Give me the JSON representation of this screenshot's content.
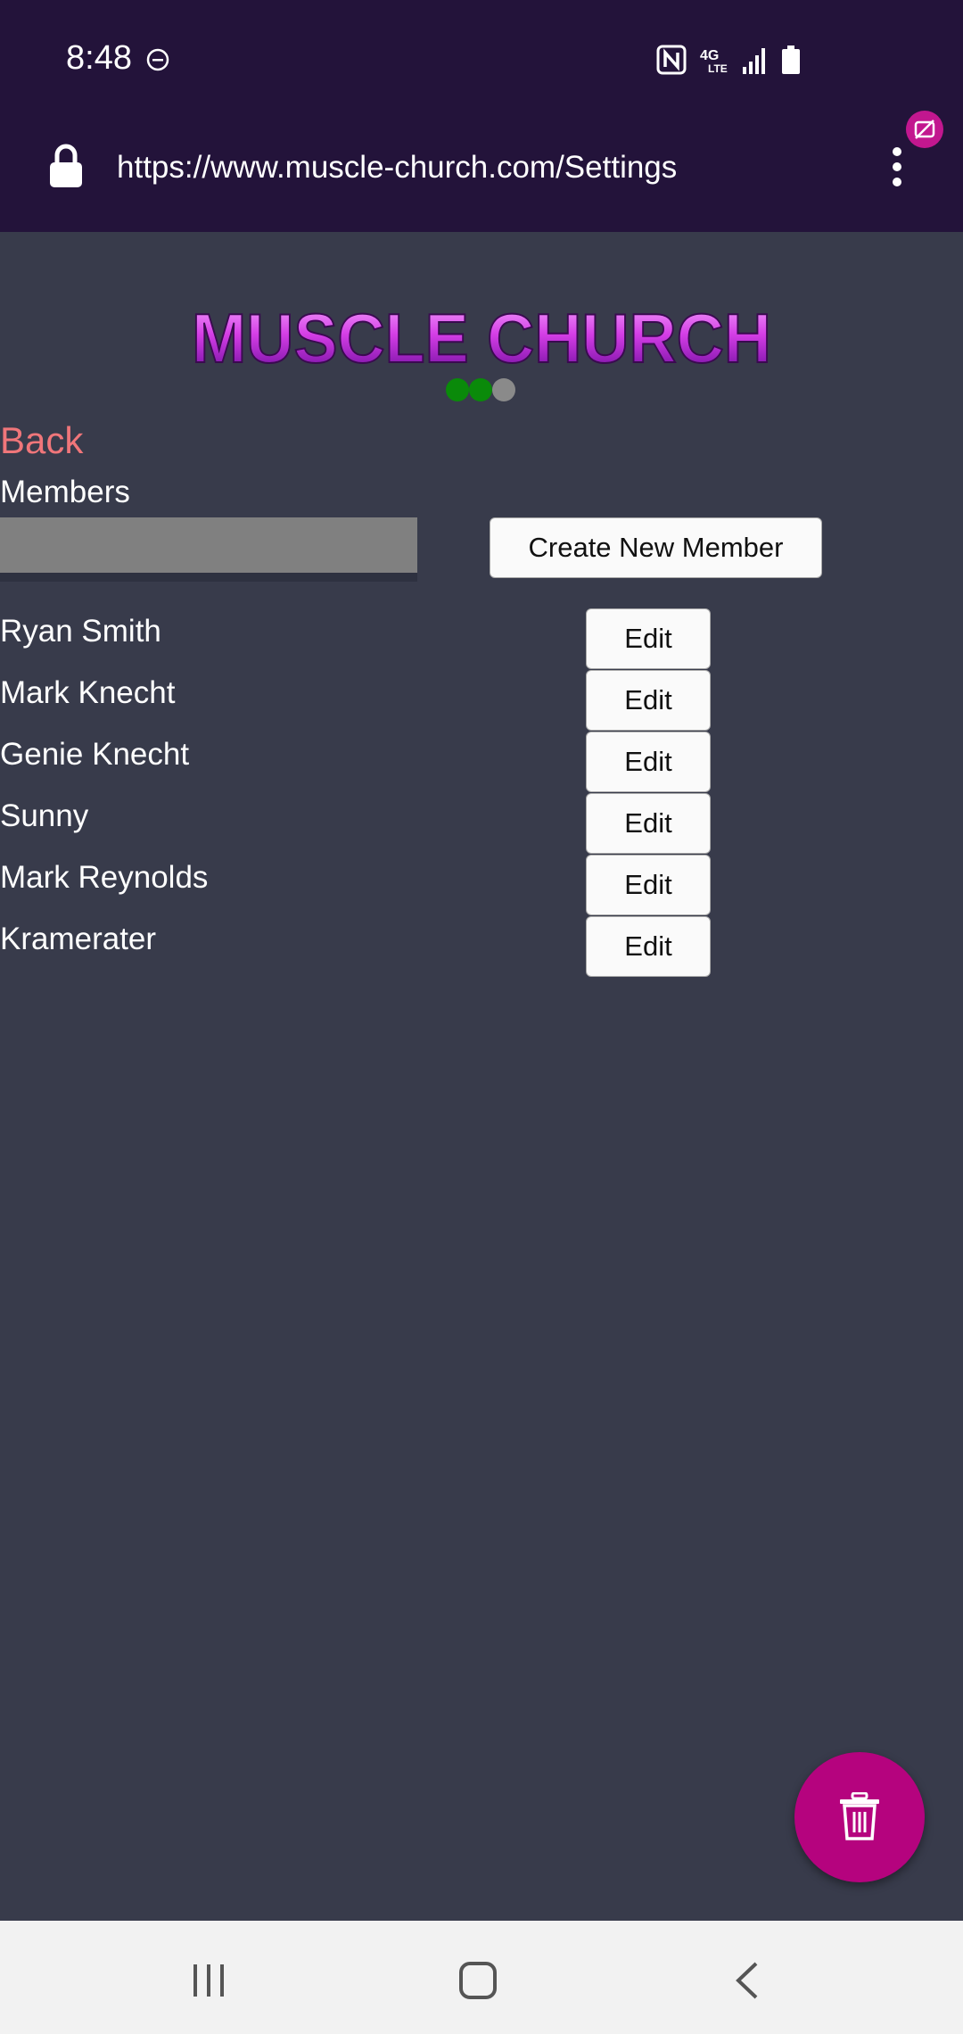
{
  "status_bar": {
    "time": "8:48",
    "icons": [
      "do-not-disturb-icon",
      "nfc-icon",
      "4g-lte-icon",
      "signal-icon",
      "battery-icon"
    ]
  },
  "browser": {
    "url": "https://www.muscle-church.com/Settings",
    "icons": [
      "lock-icon",
      "more-options-icon",
      "extension-badge-icon"
    ]
  },
  "page": {
    "logo_text": "MUSCLE CHURCH",
    "back_label": "Back",
    "section_title": "Members",
    "search": {
      "value": "",
      "placeholder": ""
    },
    "create_button_label": "Create New Member",
    "edit_label": "Edit",
    "members": [
      {
        "name": "Ryan Smith"
      },
      {
        "name": "Mark Knecht"
      },
      {
        "name": "Genie Knecht"
      },
      {
        "name": "Sunny"
      },
      {
        "name": "Mark Reynolds"
      },
      {
        "name": "Kramerater"
      }
    ],
    "step_dots": [
      "complete",
      "complete",
      "incomplete"
    ]
  },
  "fab": {
    "icon": "trash-icon"
  },
  "nav": {
    "icons": [
      "recents-icon",
      "home-icon",
      "back-icon"
    ]
  },
  "colors": {
    "status_bg": "#23133a",
    "page_bg": "#383b4b",
    "back_link": "#f0767a",
    "logo_purple": "#c020e0",
    "fab": "#b5037e",
    "dot_complete": "#0a8a0a",
    "dot_incomplete": "#8a8a8a"
  }
}
